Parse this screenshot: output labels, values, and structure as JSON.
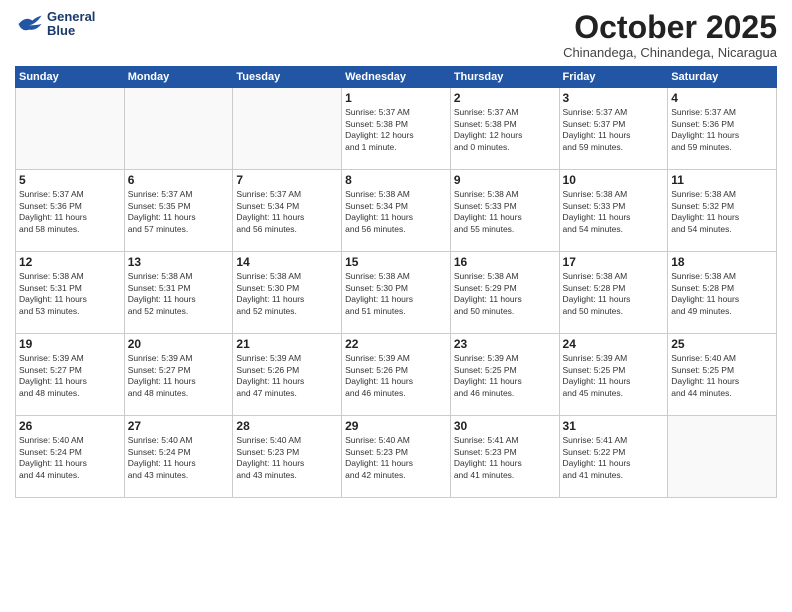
{
  "header": {
    "logo_line1": "General",
    "logo_line2": "Blue",
    "month": "October 2025",
    "location": "Chinandega, Chinandega, Nicaragua"
  },
  "weekdays": [
    "Sunday",
    "Monday",
    "Tuesday",
    "Wednesday",
    "Thursday",
    "Friday",
    "Saturday"
  ],
  "weeks": [
    [
      {
        "day": "",
        "info": ""
      },
      {
        "day": "",
        "info": ""
      },
      {
        "day": "",
        "info": ""
      },
      {
        "day": "1",
        "info": "Sunrise: 5:37 AM\nSunset: 5:38 PM\nDaylight: 12 hours\nand 1 minute."
      },
      {
        "day": "2",
        "info": "Sunrise: 5:37 AM\nSunset: 5:38 PM\nDaylight: 12 hours\nand 0 minutes."
      },
      {
        "day": "3",
        "info": "Sunrise: 5:37 AM\nSunset: 5:37 PM\nDaylight: 11 hours\nand 59 minutes."
      },
      {
        "day": "4",
        "info": "Sunrise: 5:37 AM\nSunset: 5:36 PM\nDaylight: 11 hours\nand 59 minutes."
      }
    ],
    [
      {
        "day": "5",
        "info": "Sunrise: 5:37 AM\nSunset: 5:36 PM\nDaylight: 11 hours\nand 58 minutes."
      },
      {
        "day": "6",
        "info": "Sunrise: 5:37 AM\nSunset: 5:35 PM\nDaylight: 11 hours\nand 57 minutes."
      },
      {
        "day": "7",
        "info": "Sunrise: 5:37 AM\nSunset: 5:34 PM\nDaylight: 11 hours\nand 56 minutes."
      },
      {
        "day": "8",
        "info": "Sunrise: 5:38 AM\nSunset: 5:34 PM\nDaylight: 11 hours\nand 56 minutes."
      },
      {
        "day": "9",
        "info": "Sunrise: 5:38 AM\nSunset: 5:33 PM\nDaylight: 11 hours\nand 55 minutes."
      },
      {
        "day": "10",
        "info": "Sunrise: 5:38 AM\nSunset: 5:33 PM\nDaylight: 11 hours\nand 54 minutes."
      },
      {
        "day": "11",
        "info": "Sunrise: 5:38 AM\nSunset: 5:32 PM\nDaylight: 11 hours\nand 54 minutes."
      }
    ],
    [
      {
        "day": "12",
        "info": "Sunrise: 5:38 AM\nSunset: 5:31 PM\nDaylight: 11 hours\nand 53 minutes."
      },
      {
        "day": "13",
        "info": "Sunrise: 5:38 AM\nSunset: 5:31 PM\nDaylight: 11 hours\nand 52 minutes."
      },
      {
        "day": "14",
        "info": "Sunrise: 5:38 AM\nSunset: 5:30 PM\nDaylight: 11 hours\nand 52 minutes."
      },
      {
        "day": "15",
        "info": "Sunrise: 5:38 AM\nSunset: 5:30 PM\nDaylight: 11 hours\nand 51 minutes."
      },
      {
        "day": "16",
        "info": "Sunrise: 5:38 AM\nSunset: 5:29 PM\nDaylight: 11 hours\nand 50 minutes."
      },
      {
        "day": "17",
        "info": "Sunrise: 5:38 AM\nSunset: 5:28 PM\nDaylight: 11 hours\nand 50 minutes."
      },
      {
        "day": "18",
        "info": "Sunrise: 5:38 AM\nSunset: 5:28 PM\nDaylight: 11 hours\nand 49 minutes."
      }
    ],
    [
      {
        "day": "19",
        "info": "Sunrise: 5:39 AM\nSunset: 5:27 PM\nDaylight: 11 hours\nand 48 minutes."
      },
      {
        "day": "20",
        "info": "Sunrise: 5:39 AM\nSunset: 5:27 PM\nDaylight: 11 hours\nand 48 minutes."
      },
      {
        "day": "21",
        "info": "Sunrise: 5:39 AM\nSunset: 5:26 PM\nDaylight: 11 hours\nand 47 minutes."
      },
      {
        "day": "22",
        "info": "Sunrise: 5:39 AM\nSunset: 5:26 PM\nDaylight: 11 hours\nand 46 minutes."
      },
      {
        "day": "23",
        "info": "Sunrise: 5:39 AM\nSunset: 5:25 PM\nDaylight: 11 hours\nand 46 minutes."
      },
      {
        "day": "24",
        "info": "Sunrise: 5:39 AM\nSunset: 5:25 PM\nDaylight: 11 hours\nand 45 minutes."
      },
      {
        "day": "25",
        "info": "Sunrise: 5:40 AM\nSunset: 5:25 PM\nDaylight: 11 hours\nand 44 minutes."
      }
    ],
    [
      {
        "day": "26",
        "info": "Sunrise: 5:40 AM\nSunset: 5:24 PM\nDaylight: 11 hours\nand 44 minutes."
      },
      {
        "day": "27",
        "info": "Sunrise: 5:40 AM\nSunset: 5:24 PM\nDaylight: 11 hours\nand 43 minutes."
      },
      {
        "day": "28",
        "info": "Sunrise: 5:40 AM\nSunset: 5:23 PM\nDaylight: 11 hours\nand 43 minutes."
      },
      {
        "day": "29",
        "info": "Sunrise: 5:40 AM\nSunset: 5:23 PM\nDaylight: 11 hours\nand 42 minutes."
      },
      {
        "day": "30",
        "info": "Sunrise: 5:41 AM\nSunset: 5:23 PM\nDaylight: 11 hours\nand 41 minutes."
      },
      {
        "day": "31",
        "info": "Sunrise: 5:41 AM\nSunset: 5:22 PM\nDaylight: 11 hours\nand 41 minutes."
      },
      {
        "day": "",
        "info": ""
      }
    ]
  ]
}
